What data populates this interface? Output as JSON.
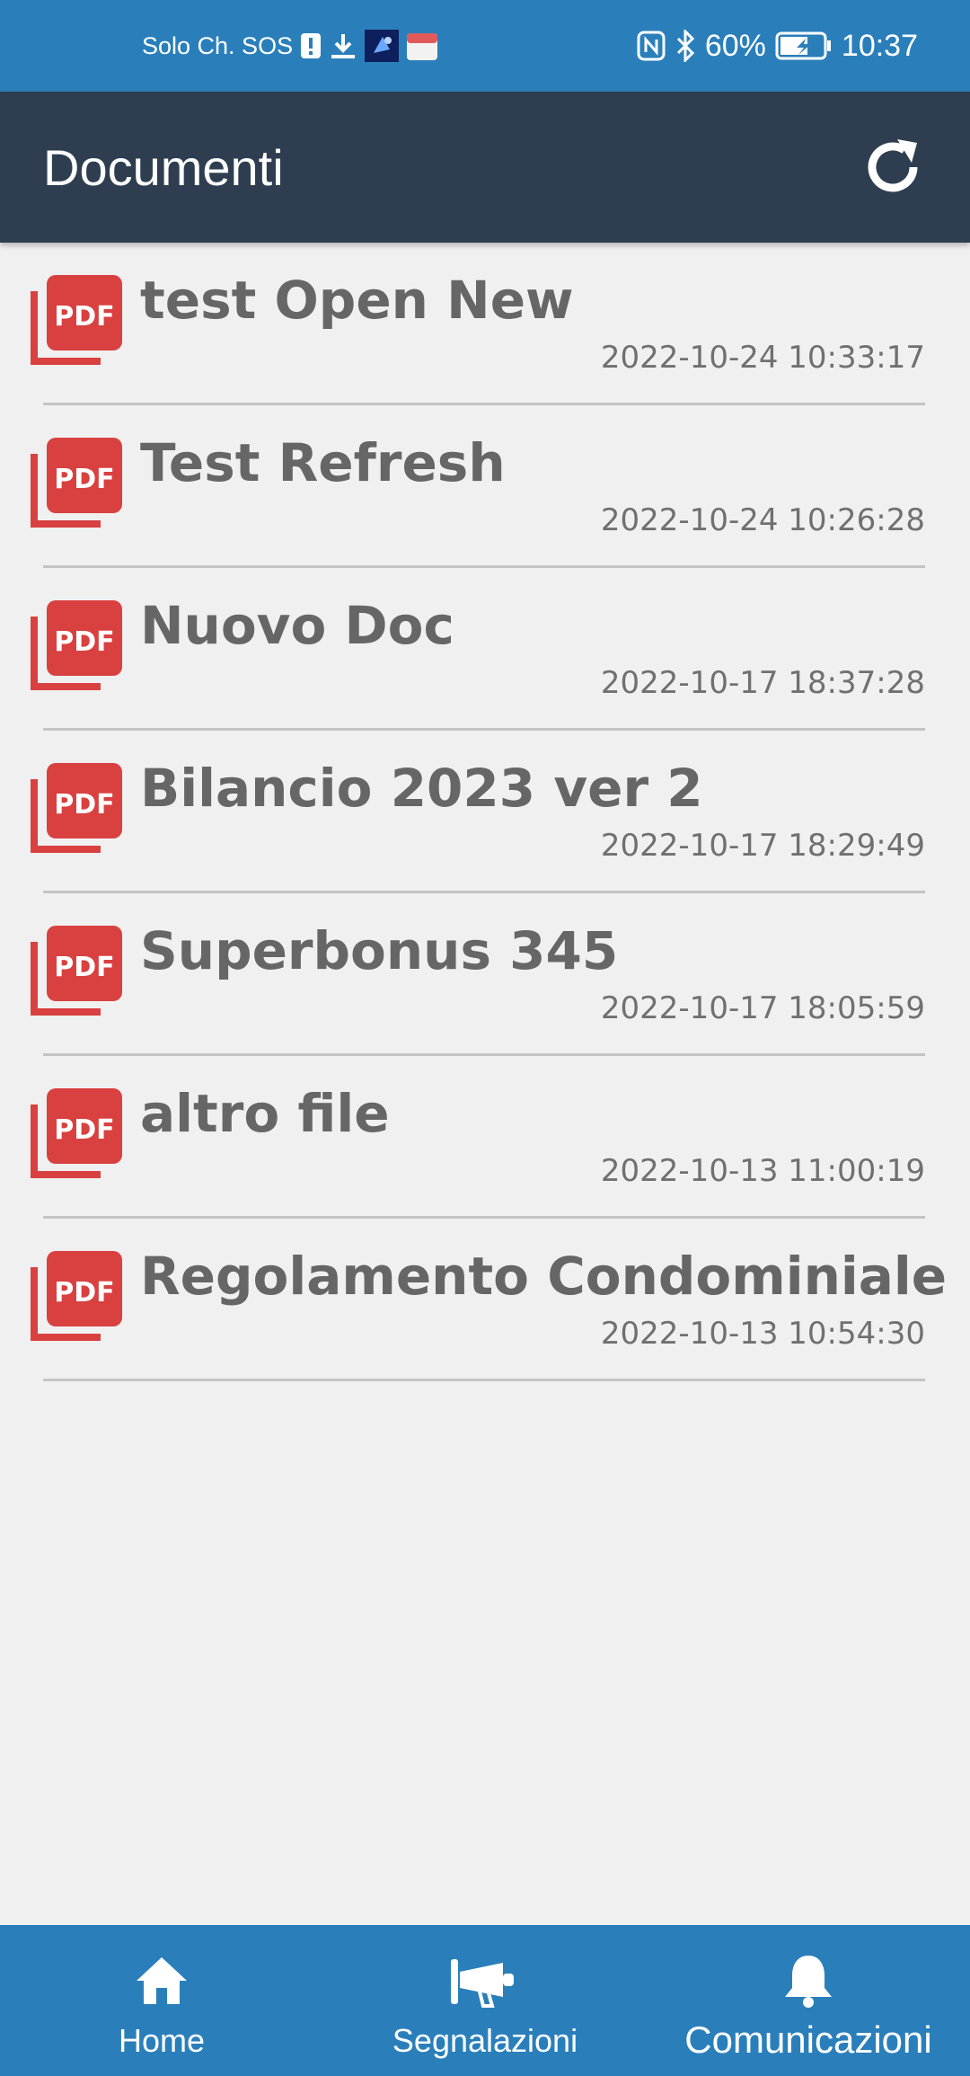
{
  "status_bar": {
    "carrier": "Solo Ch. SOS",
    "battery": "60%",
    "time": "10:37"
  },
  "app_bar": {
    "title": "Documenti"
  },
  "documents": [
    {
      "title": "test Open New",
      "date": "2022-10-24 10:33:17"
    },
    {
      "title": "Test Refresh",
      "date": "2022-10-24 10:26:28"
    },
    {
      "title": "Nuovo Doc",
      "date": "2022-10-17 18:37:28"
    },
    {
      "title": "Bilancio 2023 ver 2",
      "date": "2022-10-17 18:29:49"
    },
    {
      "title": "Superbonus 345",
      "date": "2022-10-17 18:05:59"
    },
    {
      "title": "altro file",
      "date": "2022-10-13 11:00:19"
    },
    {
      "title": "Regolamento Condominiale",
      "date": "2022-10-13 10:54:30"
    }
  ],
  "pdf_label": "PDF",
  "bottom_nav": {
    "home": "Home",
    "segnalazioni": "Segnalazioni",
    "comunicazioni": "Comunicazioni"
  },
  "colors": {
    "status_bar": "#2a7fbb",
    "app_bar": "#2e3e50",
    "pdf_red": "#d94040",
    "bottom_nav": "#2a7fbb"
  }
}
